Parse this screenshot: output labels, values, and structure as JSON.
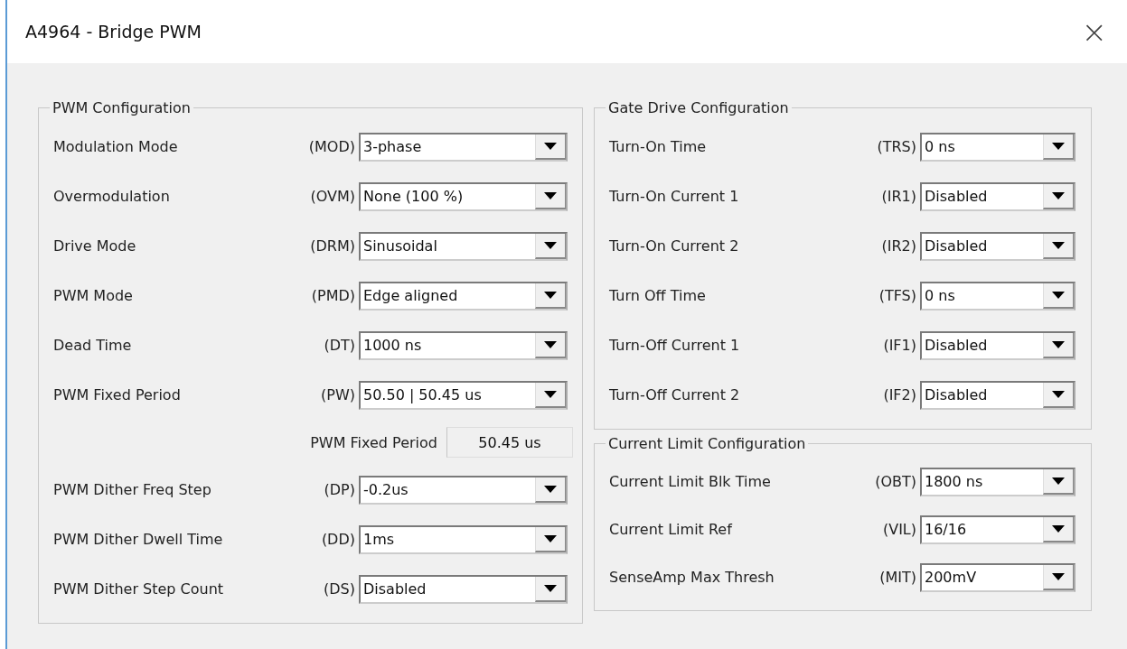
{
  "window": {
    "title": "A4964 - Bridge PWM",
    "close": "×"
  },
  "columns": [
    {
      "groups": [
        {
          "title": "PWM Configuration",
          "rows": [
            {
              "kind": "dropdown",
              "label": "Modulation Mode",
              "code": "(MOD)",
              "value": "3-phase"
            },
            {
              "kind": "dropdown",
              "label": "Overmodulation",
              "code": "(OVM)",
              "value": "None (100 %)"
            },
            {
              "kind": "dropdown",
              "label": "Drive Mode",
              "code": "(DRM)",
              "value": "Sinusoidal"
            },
            {
              "kind": "dropdown",
              "label": "PWM Mode",
              "code": "(PMD)",
              "value": "Edge aligned"
            },
            {
              "kind": "dropdown",
              "label": "Dead Time",
              "code": "(DT)",
              "value": "1000 ns"
            },
            {
              "kind": "dropdown",
              "label": "PWM Fixed Period",
              "code": "(PW)",
              "value": "50.50 | 50.45 us"
            },
            {
              "kind": "readout",
              "label": "PWM Fixed Period",
              "value": "50.45 us"
            },
            {
              "kind": "dropdown",
              "label": "PWM Dither Freq Step",
              "code": "(DP)",
              "value": "-0.2us"
            },
            {
              "kind": "dropdown",
              "label": "PWM Dither Dwell Time",
              "code": "(DD)",
              "value": "1ms"
            },
            {
              "kind": "dropdown",
              "label": "PWM Dither Step Count",
              "code": "(DS)",
              "value": "Disabled"
            }
          ]
        }
      ]
    },
    {
      "groups": [
        {
          "title": "Gate Drive Configuration",
          "rows": [
            {
              "kind": "dropdown",
              "label": "Turn-On Time",
              "code": "(TRS)",
              "value": "0 ns"
            },
            {
              "kind": "dropdown",
              "label": "Turn-On Current 1",
              "code": "(IR1)",
              "value": "Disabled"
            },
            {
              "kind": "dropdown",
              "label": "Turn-On Current 2",
              "code": "(IR2)",
              "value": "Disabled"
            },
            {
              "kind": "dropdown",
              "label": "Turn Off Time",
              "code": "(TFS)",
              "value": "0 ns"
            },
            {
              "kind": "dropdown",
              "label": "Turn-Off Current 1",
              "code": "(IF1)",
              "value": "Disabled"
            },
            {
              "kind": "dropdown",
              "label": "Turn-Off Current 2",
              "code": "(IF2)",
              "value": "Disabled"
            }
          ]
        },
        {
          "title": "Current Limit Configuration",
          "rows": [
            {
              "kind": "dropdown",
              "label": "Current Limit Blk Time",
              "code": "(OBT)",
              "value": "1800 ns"
            },
            {
              "kind": "dropdown",
              "label": "Current Limit Ref",
              "code": "(VIL)",
              "value": "16/16"
            },
            {
              "kind": "dropdown",
              "label": "SenseAmp Max Thresh",
              "code": "(MIT)",
              "value": "200mV"
            }
          ]
        }
      ]
    }
  ]
}
